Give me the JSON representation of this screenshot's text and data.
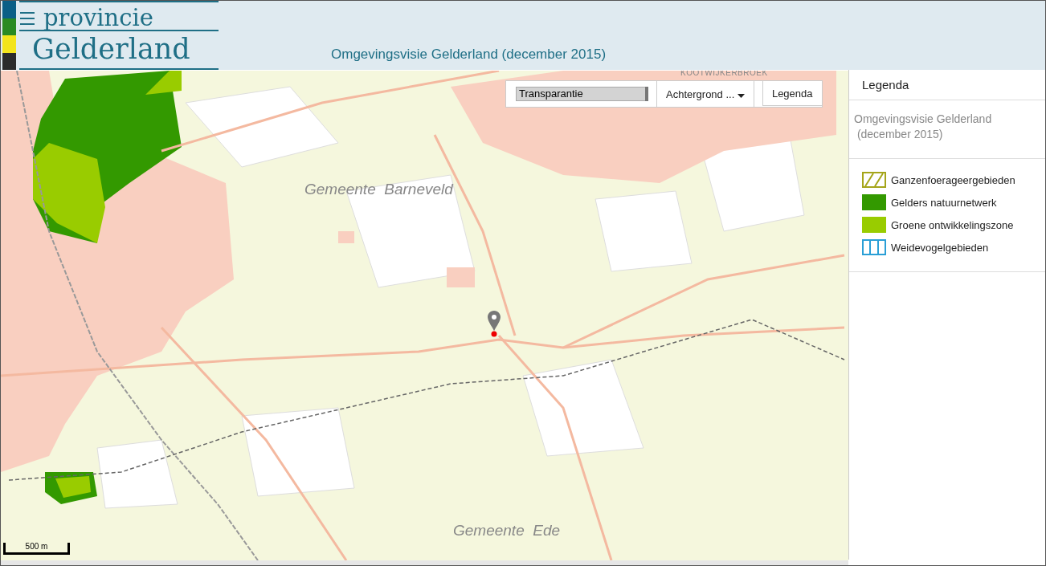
{
  "header": {
    "logo_top": "provincie",
    "logo_bottom": "Gelderland",
    "title": "Omgevingsvisie Gelderland (december 2015)"
  },
  "map": {
    "place_labels": [
      {
        "kind": "village",
        "text": "KOOTWIJKERBROEK"
      },
      {
        "kind": "municipality",
        "text": "Gemeente  Barneveld"
      },
      {
        "kind": "municipality",
        "text": "Gemeente  Ede"
      }
    ],
    "scale": "500 m",
    "toolbar": {
      "transparency": {
        "label": "Transparantie",
        "level": 1
      },
      "background_button": "Achtergrond ...",
      "legend_button": "Legenda"
    }
  },
  "legend": {
    "title": "Legenda",
    "layer": "Omgevingsvisie Gelderland\n (december 2015)",
    "items": [
      {
        "kind": "hatch",
        "color": "#a5a51a",
        "label": "Ganzenfoerageergebieden"
      },
      {
        "kind": "solid",
        "color": "#339900",
        "label": "Gelders natuurnetwerk"
      },
      {
        "kind": "solid",
        "color": "#99cc00",
        "label": "Groene ontwikkelingszone"
      },
      {
        "kind": "bars",
        "color": "#2a9fd6",
        "label": "Weidevogelgebieden"
      }
    ]
  }
}
